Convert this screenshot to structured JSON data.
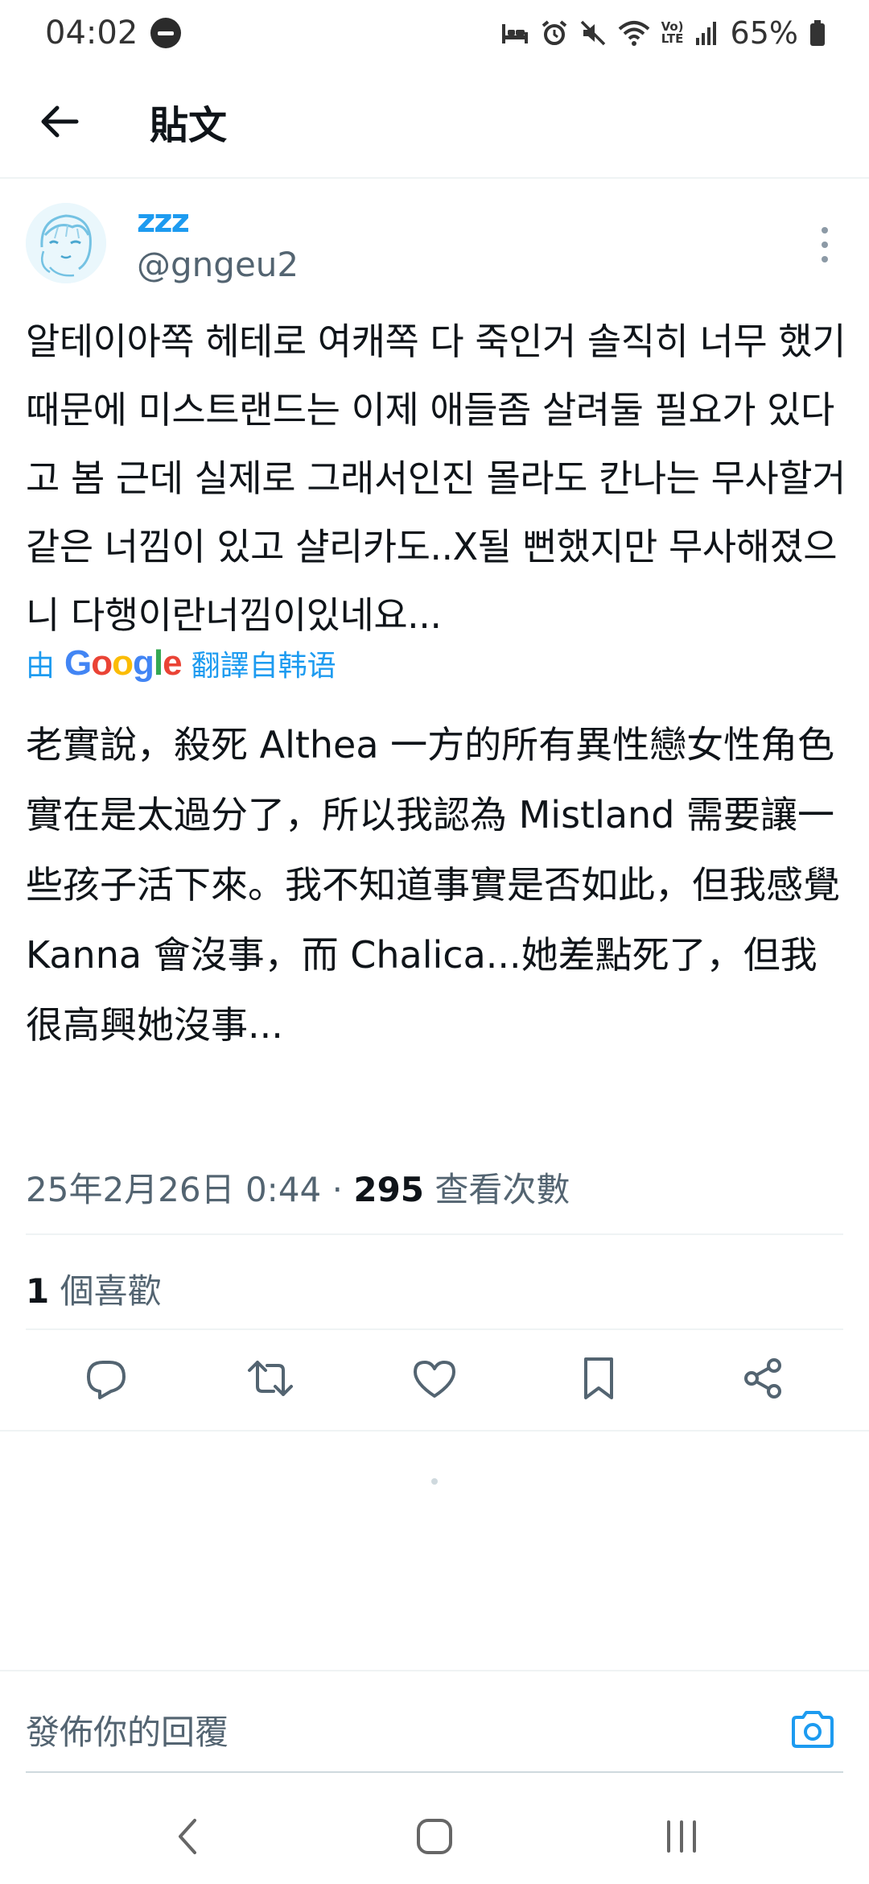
{
  "status_bar": {
    "time": "04:02",
    "battery": "65%",
    "volte_top": "Vo)",
    "volte_bottom": "LTE"
  },
  "header": {
    "title": "貼文"
  },
  "tweet": {
    "author_name": "zzz",
    "handle": "@gngeu2",
    "text": "알테이아쪽 헤테로 여캐쪽 다 죽인거 솔직히 너무 했기때문에 미스트랜드는 이제 애들좀 살려둘 필요가 있다고 봄 근데 실제로 그래서인진 몰라도 칸나는 무사할거같은 너낌이 있고 샬리카도..X될 뻔했지만 무사해졌으니 다행이란너낌이있네요...",
    "translate_prefix": "由",
    "translate_google": "Google",
    "translate_suffix": "翻譯自韩语",
    "translated_text": "老實說，殺死 Althea 一方的所有異性戀女性角色實在是太過分了，所以我認為 Mistland 需要讓一些孩子活下來。我不知道事實是否如此，但我感覺 Kanna 會沒事，而 Chalica...她差點死了，但我很高興她沒事...",
    "timestamp": "25年2月26日 0:44",
    "separator": "·",
    "views_count": "295",
    "views_label": "查看次數",
    "likes_count": "1",
    "likes_label": "個喜歡"
  },
  "reply": {
    "placeholder": "發佈你的回覆"
  },
  "colors": {
    "accent": "#1d9bf0",
    "text_primary": "#0f1419",
    "text_secondary": "#536471",
    "divider": "#eff3f4"
  },
  "icons": {
    "back": "arrow-left-icon",
    "more": "more-vertical-icon",
    "reply": "reply-icon",
    "retweet": "retweet-icon",
    "like": "heart-icon",
    "bookmark": "bookmark-icon",
    "share": "share-icon",
    "camera": "camera-icon"
  }
}
